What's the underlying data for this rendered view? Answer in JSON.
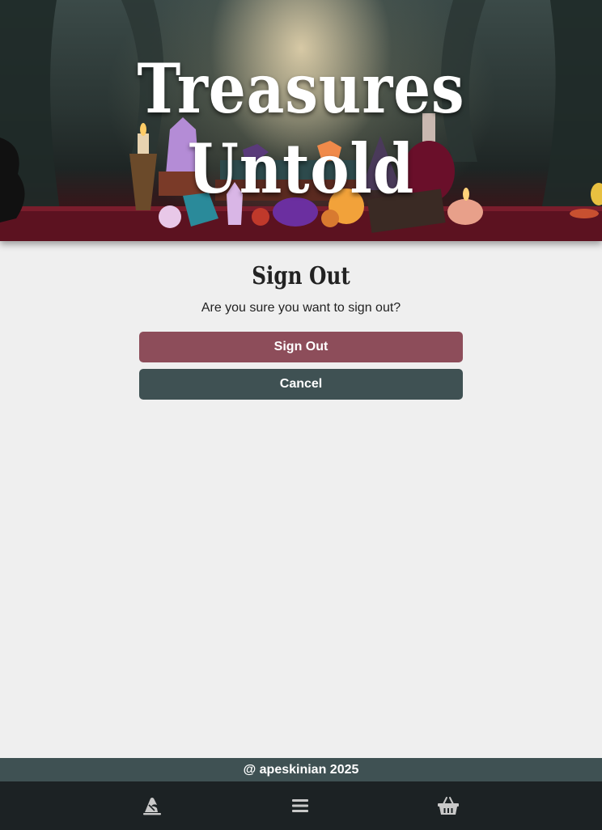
{
  "hero": {
    "title": "Treasures Untold"
  },
  "main": {
    "heading": "Sign Out",
    "question": "Are you sure you want to sign out?",
    "signout_label": "Sign Out",
    "cancel_label": "Cancel"
  },
  "footer": {
    "text": "@ apeskinian 2025"
  },
  "nav": {
    "home_icon": "wizard-hat-icon",
    "menu_icon": "hamburger-menu-icon",
    "cart_icon": "shopping-basket-icon"
  },
  "colors": {
    "signout_button": "#8d4d5a",
    "cancel_button": "#3f5153",
    "footer": "#3f5153",
    "bottom_nav": "#1c2224",
    "page_background": "#efefef",
    "nav_icon": "#c9c9c9"
  }
}
